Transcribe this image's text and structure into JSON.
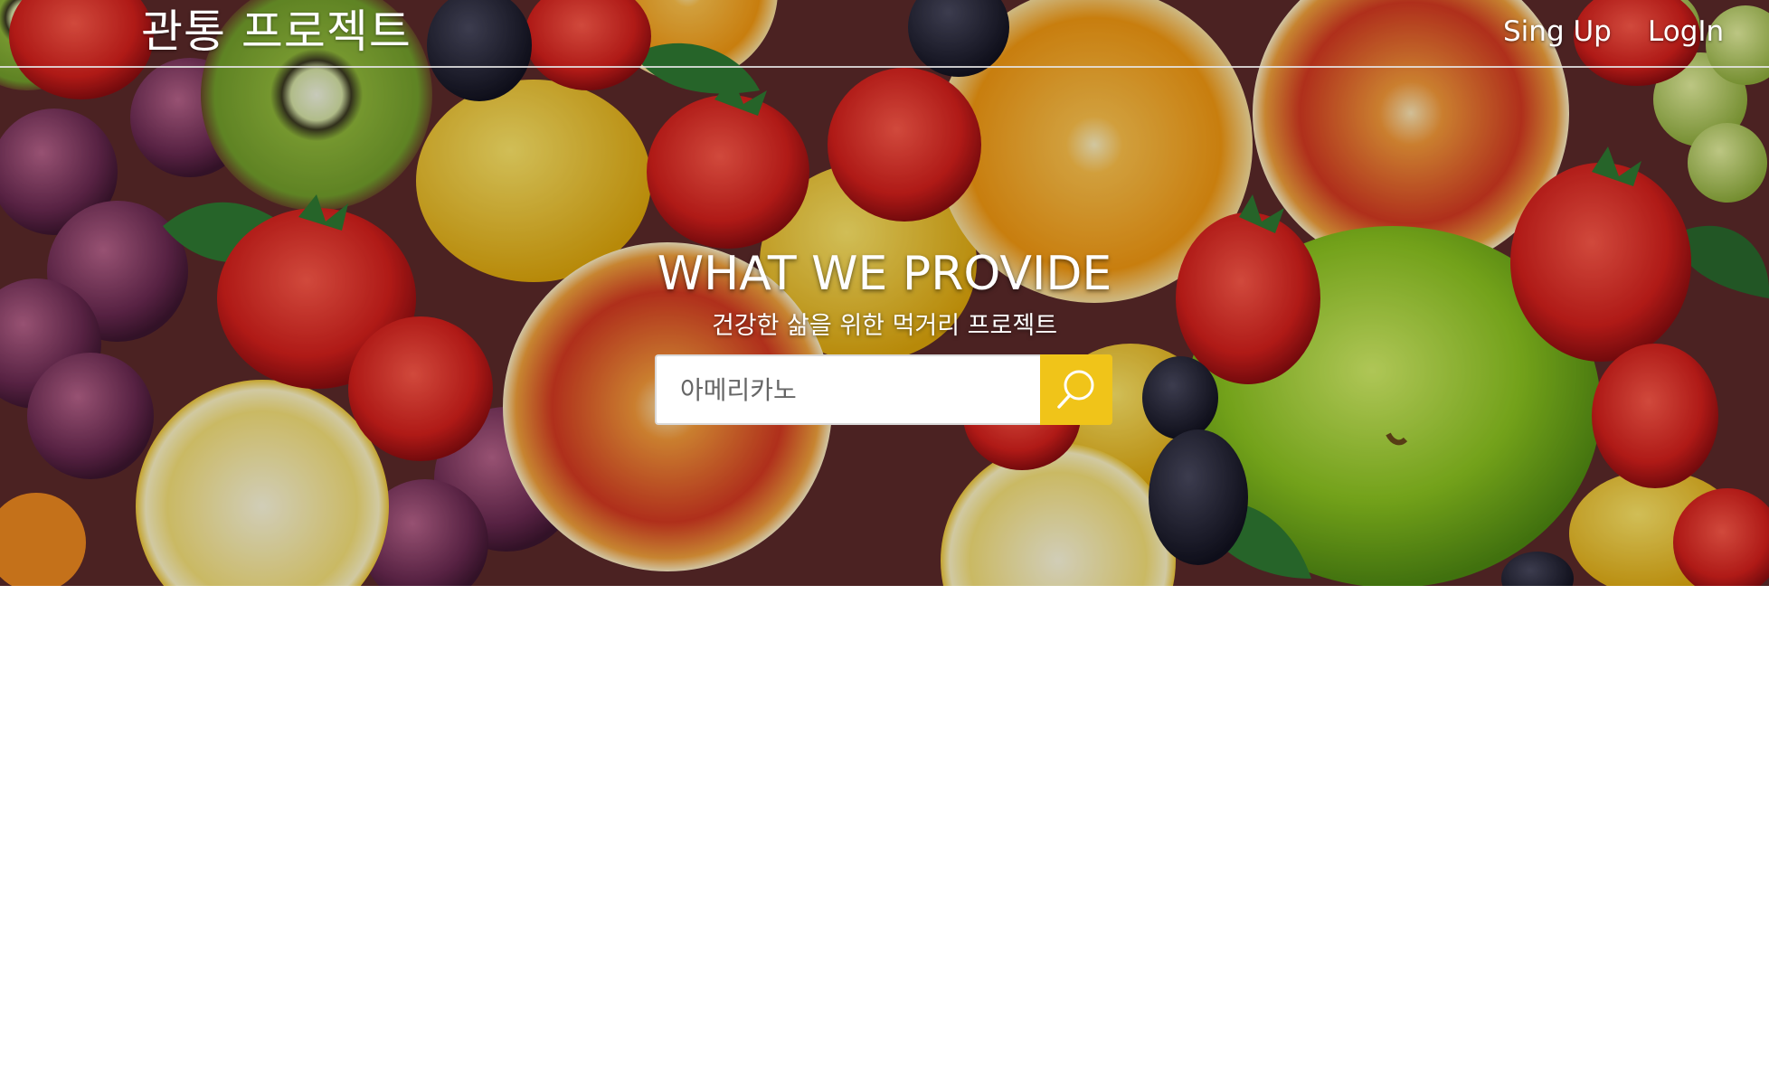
{
  "header": {
    "brand": "관통 프로젝트",
    "nav": {
      "signup_label": "Sing Up",
      "login_label": "LogIn"
    }
  },
  "hero": {
    "background": "fruit-assortment-photo",
    "title": "WHAT WE PROVIDE",
    "subtitle": "건강한 삶을 위한 먹거리 프로젝트"
  },
  "search": {
    "placeholder": "아메리카노",
    "value": "",
    "button_icon": "search-icon",
    "button_color": "#f0c419"
  }
}
